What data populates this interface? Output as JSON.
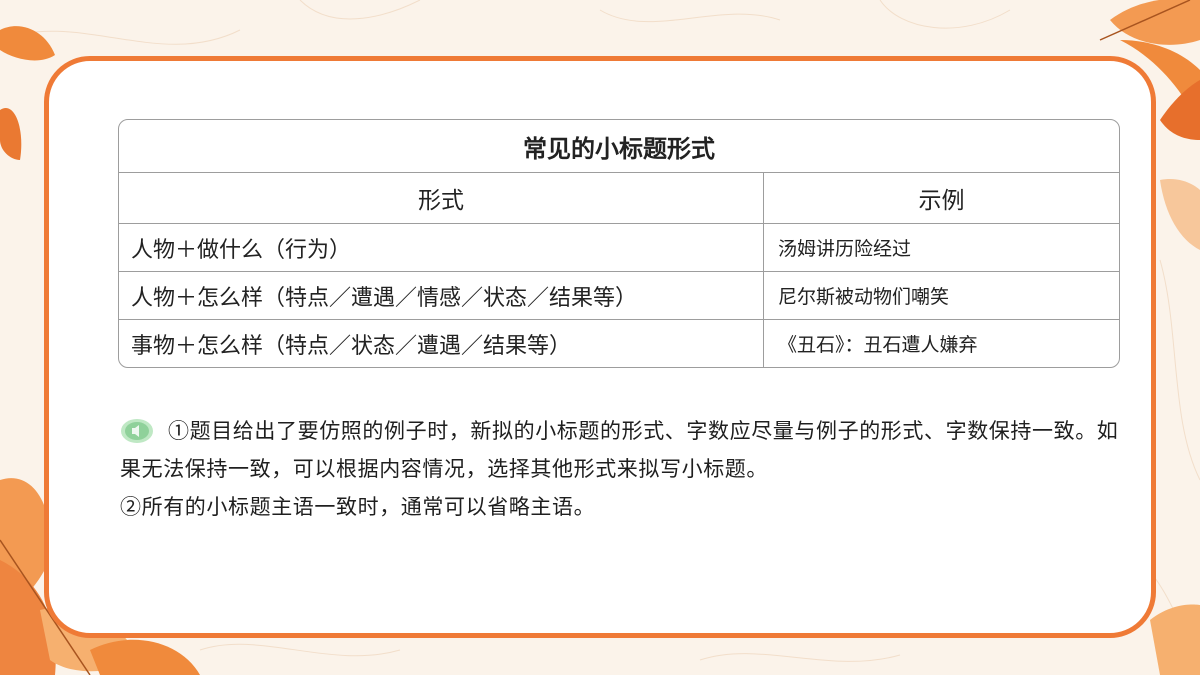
{
  "table": {
    "title": "常见的小标题形式",
    "headers": [
      "形式",
      "示例"
    ],
    "rows": [
      [
        "人物＋做什么（行为）",
        "汤姆讲历险经过"
      ],
      [
        "人物＋怎么样（特点／遭遇／情感／状态／结果等）",
        "尼尔斯被动物们嘲笑"
      ],
      [
        "事物＋怎么样（特点／状态／遭遇／结果等）",
        "《丑石》：丑石遭人嫌弃"
      ]
    ]
  },
  "notes": {
    "icon": "speaker-icon",
    "line1": "①题目给出了要仿照的例子时，新拟的小标题的形式、字数应尽量与例子的形式、字数保持一致。如果无法保持一致，可以根据内容情况，选择其他形式来拟写小标题。",
    "line2": "②所有的小标题主语一致时，通常可以省略主语。"
  },
  "colors": {
    "frame": "#ef7a36",
    "leaf": "#f08a3c",
    "icon": "#8fd19a"
  }
}
